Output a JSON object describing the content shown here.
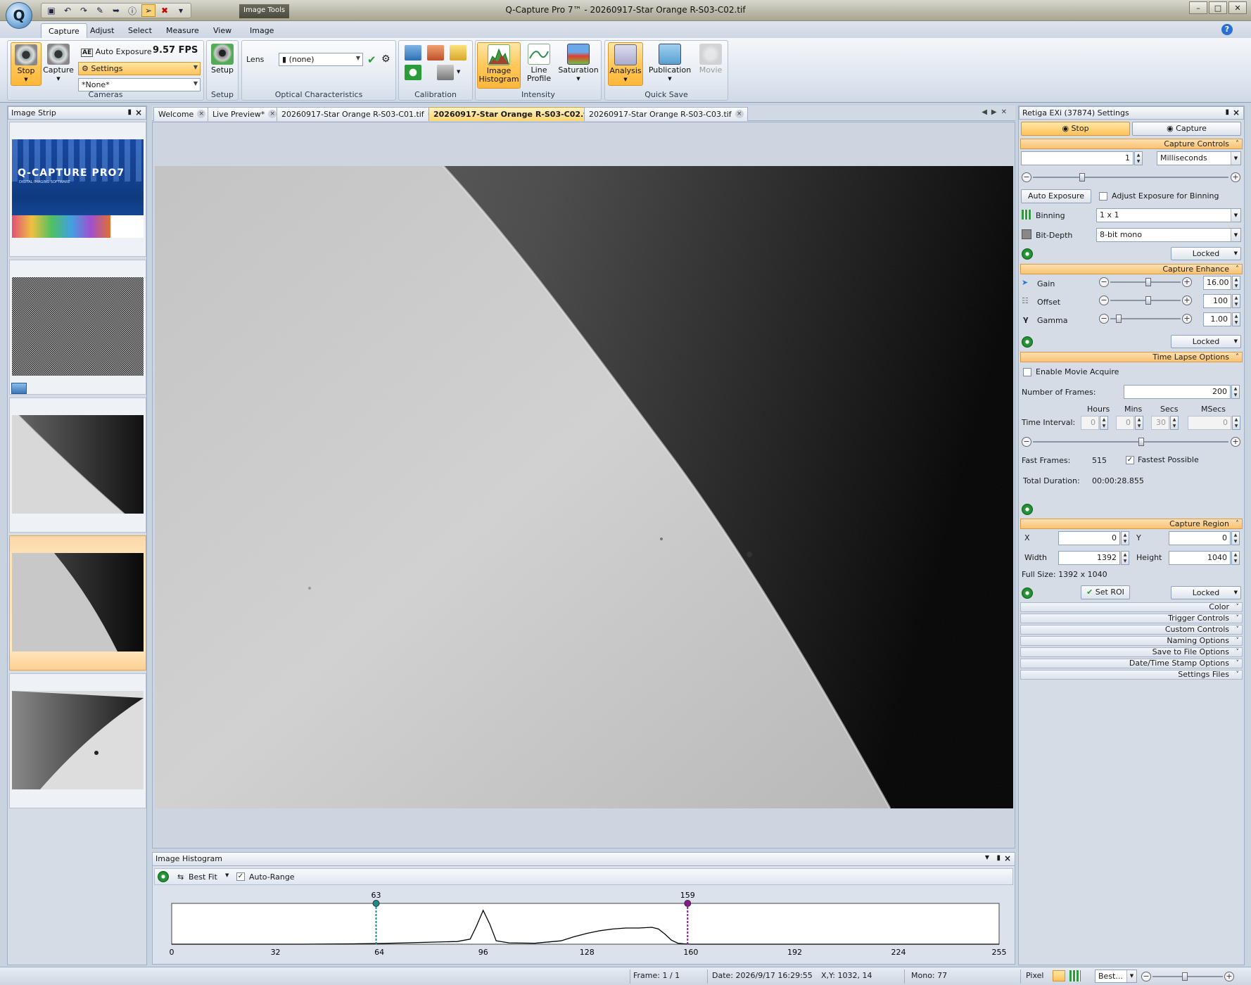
{
  "window": {
    "title": "Q-Capture Pro 7™ - 20260917-Star Orange R-S03-C02.tif",
    "image_tools_tag": "Image Tools",
    "controls": [
      "–",
      "□",
      "✕"
    ]
  },
  "ribbon_tabs": [
    "Capture",
    "Adjust",
    "Select",
    "Measure",
    "View",
    "Image"
  ],
  "ribbon": {
    "cameras": {
      "label": "Cameras",
      "stop": "Stop",
      "capture": "Capture",
      "auto_exposure": "Auto Exposure",
      "fps": "9.57 FPS",
      "settings": "Settings",
      "preset": "*None*"
    },
    "setup": {
      "label": "Setup",
      "button": "Setup"
    },
    "optical": {
      "label": "Optical Characteristics",
      "lens_label": "Lens",
      "lens_value": "(none)"
    },
    "calibration": {
      "label": "Calibration"
    },
    "intensity": {
      "label": "Intensity",
      "image_histogram": "Image Histogram",
      "line_profile": "Line Profile",
      "saturation": "Saturation"
    },
    "quicksave": {
      "label": "Quick Save",
      "analysis": "Analysis",
      "publication": "Publication",
      "movie": "Movie"
    }
  },
  "image_strip": {
    "title": "Image Strip",
    "splash_title": "Q-CAPTURE PRO7",
    "splash_subtitle": "DIGITAL IMAGING SOFTWARE"
  },
  "doc_tabs": [
    "Welcome",
    "Live Preview*",
    "20260917-Star Orange R-S03-C01.tif",
    "20260917-Star Orange R-S03-C02.tif",
    "20260917-Star Orange R-S03-C03.tif"
  ],
  "histogram": {
    "title": "Image Histogram",
    "best_fit": "Best Fit",
    "auto_range": "Auto-Range",
    "marker_low": "63",
    "marker_high": "159",
    "ticks": [
      "0",
      "32",
      "64",
      "96",
      "128",
      "160",
      "192",
      "224",
      "255"
    ]
  },
  "chart_data": {
    "type": "area",
    "title": "",
    "xlabel": "",
    "ylabel": "",
    "xlim": [
      0,
      255
    ],
    "x": [
      0,
      40,
      56,
      64,
      72,
      80,
      88,
      92,
      94,
      96,
      98,
      100,
      104,
      112,
      120,
      124,
      128,
      132,
      136,
      140,
      144,
      148,
      150,
      152,
      154,
      156,
      158,
      160,
      176,
      200,
      255
    ],
    "values": [
      0,
      0,
      0.01,
      0.02,
      0.04,
      0.06,
      0.08,
      0.15,
      0.55,
      1.0,
      0.6,
      0.1,
      0.04,
      0.03,
      0.1,
      0.22,
      0.32,
      0.4,
      0.45,
      0.48,
      0.48,
      0.5,
      0.45,
      0.3,
      0.12,
      0.03,
      0.01,
      0,
      0,
      0,
      0
    ],
    "markers": [
      63,
      159
    ],
    "grid": false,
    "legend": "none"
  },
  "settings": {
    "title": "Retiga EXi (37874) Settings",
    "stop": "Stop",
    "capture": "Capture",
    "capture_controls": {
      "header": "Capture Controls",
      "exposure_value": "1",
      "exposure_unit": "Milliseconds",
      "auto_exposure_btn": "Auto Exposure",
      "adjust_binning": "Adjust Exposure for Binning",
      "binning_label": "Binning",
      "binning_value": "1 x 1",
      "bitdepth_label": "Bit-Depth",
      "bitdepth_value": "8-bit mono",
      "locked": "Locked"
    },
    "capture_enhance": {
      "header": "Capture Enhance",
      "gain_label": "Gain",
      "gain_value": "16.00",
      "offset_label": "Offset",
      "offset_value": "100",
      "gamma_label": "Gamma",
      "gamma_value": "1.00",
      "locked": "Locked"
    },
    "time_lapse": {
      "header": "Time Lapse Options",
      "enable_movie": "Enable Movie Acquire",
      "frames_label": "Number of  Frames:",
      "frames_value": "200",
      "hours": "Hours",
      "mins": "Mins",
      "secs": "Secs",
      "msecs": "MSecs",
      "interval_label": "Time Interval:",
      "h": "0",
      "m": "0",
      "s": "30",
      "ms": "0",
      "fast_frames_label": "Fast Frames:",
      "fast_frames_value": "515",
      "fastest": "Fastest Possible",
      "duration_label": "Total Duration:",
      "duration_value": "00:00:28.855"
    },
    "capture_region": {
      "header": "Capture Region",
      "x_label": "X",
      "x_value": "0",
      "y_label": "Y",
      "y_value": "0",
      "width_label": "Width",
      "width_value": "1392",
      "height_label": "Height",
      "height_value": "1040",
      "full_size": "Full Size: 1392 x 1040",
      "set_roi": "Set ROI",
      "locked": "Locked"
    },
    "collapsed": [
      "Color",
      "Trigger Controls",
      "Custom Controls",
      "Naming Options",
      "Save to File Options",
      "Date/Time Stamp Options",
      "Settings Files"
    ]
  },
  "status": {
    "frame": "Frame: 1 / 1",
    "date": "Date: 2026/9/17 16:29:55",
    "xy": "X,Y: 1032,   14",
    "mono": "Mono:   77",
    "pixel": "Pixel",
    "zoom": "Best..."
  },
  "colors": {
    "accent_orange": "#f9c273",
    "marker_low": "#1a8c8c",
    "marker_high": "#8a1a8a"
  }
}
